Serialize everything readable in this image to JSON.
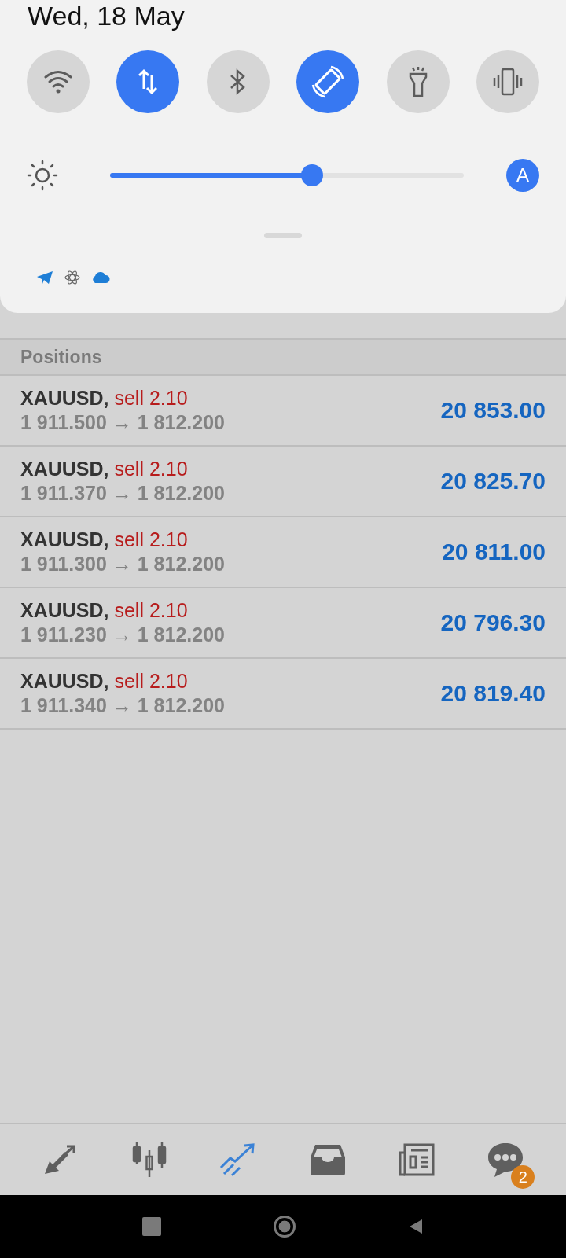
{
  "quick_panel": {
    "date": "Wed, 18 May",
    "tiles": [
      {
        "kind": "wifi",
        "on": false
      },
      {
        "kind": "data",
        "on": true
      },
      {
        "kind": "bluetooth",
        "on": false
      },
      {
        "kind": "rotate",
        "on": true
      },
      {
        "kind": "torch",
        "on": false
      },
      {
        "kind": "vibrate",
        "on": false
      }
    ],
    "brightness": {
      "level": 0.57,
      "auto_label": "A",
      "auto": true
    }
  },
  "positions": {
    "title": "Positions",
    "rows": [
      {
        "symbol": "XAUUSD,",
        "side": "sell 2.10",
        "prices": "1 911.500 → 1 812.200",
        "profit": "20 853.00"
      },
      {
        "symbol": "XAUUSD,",
        "side": "sell 2.10",
        "prices": "1 911.370 → 1 812.200",
        "profit": "20 825.70"
      },
      {
        "symbol": "XAUUSD,",
        "side": "sell 2.10",
        "prices": "1 911.300 → 1 812.200",
        "profit": "20 811.00"
      },
      {
        "symbol": "XAUUSD,",
        "side": "sell 2.10",
        "prices": "1 911.230 → 1 812.200",
        "profit": "20 796.30"
      },
      {
        "symbol": "XAUUSD,",
        "side": "sell 2.10",
        "prices": "1 911.340 → 1 812.200",
        "profit": "20 819.40"
      }
    ]
  },
  "bottom_nav": [
    {
      "kind": "quotes",
      "selected": false
    },
    {
      "kind": "chart",
      "selected": false
    },
    {
      "kind": "trade",
      "selected": true
    },
    {
      "kind": "history",
      "selected": false
    },
    {
      "kind": "news",
      "selected": false
    },
    {
      "kind": "chat",
      "selected": false,
      "badge": "2"
    }
  ]
}
